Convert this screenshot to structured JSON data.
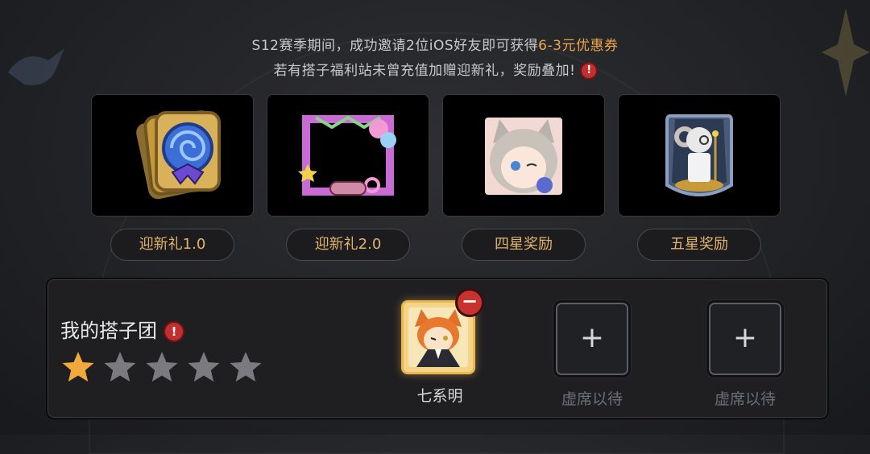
{
  "notice": {
    "line1_prefix": "S12赛季期间，成功邀请2位iOS好友即可获得",
    "line1_highlight": "6-3元优惠券",
    "line2_text": "若有搭子福利站未曾充值加赠迎新礼，奖励叠加!",
    "warn_glyph": "!"
  },
  "rewards": [
    {
      "label": "迎新礼1.0",
      "icon": "lollipop-card-icon"
    },
    {
      "label": "迎新礼2.0",
      "icon": "party-frame-icon"
    },
    {
      "label": "四星奖励",
      "icon": "catgirl-portrait-icon"
    },
    {
      "label": "五星奖励",
      "icon": "ram-butler-portrait-icon"
    }
  ],
  "team": {
    "title": "我的搭子团",
    "warn_glyph": "!",
    "stars_filled": 1,
    "stars_total": 5,
    "member": {
      "name": "七系明",
      "remove_glyph": "−"
    },
    "empty_slots": [
      {
        "label": "虚席以待",
        "plus": "+"
      },
      {
        "label": "虚席以待",
        "plus": "+"
      }
    ]
  },
  "colors": {
    "highlight": "#f0a64a",
    "pill_text": "#e0b36a",
    "star_filled": "#f2a93b",
    "star_empty": "#7a7b80",
    "warn": "#c32f2f"
  }
}
